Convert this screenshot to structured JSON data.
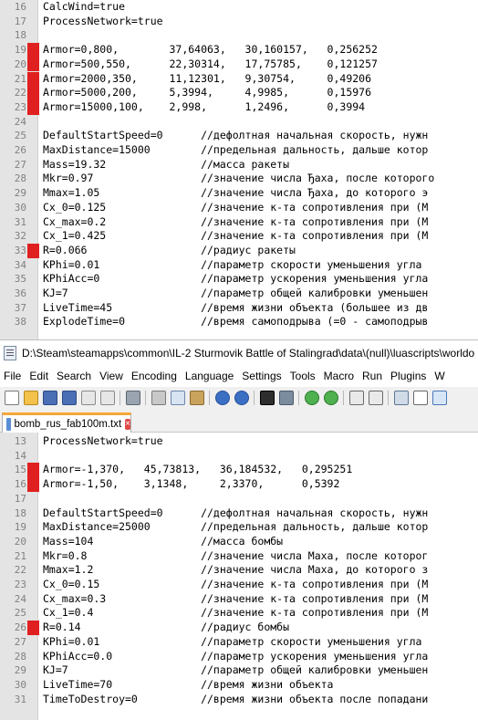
{
  "top_editor": {
    "lines": [
      {
        "num": "16",
        "text": "CalcWind=true",
        "marked": false
      },
      {
        "num": "17",
        "text": "ProcessNetwork=true",
        "marked": false
      },
      {
        "num": "18",
        "text": "",
        "marked": false
      },
      {
        "num": "19",
        "text": "Armor=0,800,        37,64063,   30,160157,   0,256252",
        "marked": true
      },
      {
        "num": "20",
        "text": "Armor=500,550,      22,30314,   17,75785,    0,121257",
        "marked": true
      },
      {
        "num": "21",
        "text": "Armor=2000,350,     11,12301,   9,30754,     0,49206",
        "marked": true
      },
      {
        "num": "22",
        "text": "Armor=5000,200,     5,3994,     4,9985,      0,15976",
        "marked": true
      },
      {
        "num": "23",
        "text": "Armor=15000,100,    2,998,      1,2496,      0,3994",
        "marked": true
      },
      {
        "num": "24",
        "text": "",
        "marked": false
      },
      {
        "num": "25",
        "text": "DefaultStartSpeed=0      //дефолтная начальная скорость, нужн",
        "marked": false
      },
      {
        "num": "26",
        "text": "MaxDistance=15000        //предельная дальность, дальше котор",
        "marked": false
      },
      {
        "num": "27",
        "text": "Mass=19.32               //масса ракеты",
        "marked": false
      },
      {
        "num": "28",
        "text": "Mkr=0.97                 //значение числа Ђаха, после которого",
        "marked": false
      },
      {
        "num": "29",
        "text": "Mmax=1.05                //значение числа Ђаха, до которого э",
        "marked": false
      },
      {
        "num": "30",
        "text": "Cx_0=0.125               //значение к-та сопротивления при (М",
        "marked": false
      },
      {
        "num": "31",
        "text": "Cx_max=0.2               //значение к-та сопротивления при (М",
        "marked": false
      },
      {
        "num": "32",
        "text": "Cx_1=0.425               //значение к-та сопротивления при (М",
        "marked": false
      },
      {
        "num": "33",
        "text": "R=0.066                  //радиус ракеты",
        "marked": true
      },
      {
        "num": "34",
        "text": "KPhi=0.01                //параметр скорости уменьшения угла",
        "marked": false
      },
      {
        "num": "35",
        "text": "KPhiAcc=0                //параметр ускорения уменьшения угла",
        "marked": false
      },
      {
        "num": "36",
        "text": "KJ=7                     //параметр общей калибровки уменьшен",
        "marked": false
      },
      {
        "num": "37",
        "text": "LiveTime=45              //время жизни объекта (большее из дв",
        "marked": false
      },
      {
        "num": "38",
        "text": "ExplodeTime=0            //время самоподрыва (=0 - самоподрыв",
        "marked": false
      }
    ]
  },
  "window": {
    "title": "D:\\Steam\\steamapps\\common\\IL-2 Sturmovik Battle of Stalingrad\\data\\(null)\\luascripts\\worldo"
  },
  "menubar": {
    "items": [
      "File",
      "Edit",
      "Search",
      "View",
      "Encoding",
      "Language",
      "Settings",
      "Tools",
      "Macro",
      "Run",
      "Plugins",
      "W"
    ]
  },
  "toolbar": {
    "icons": [
      "new-file-icon",
      "open-file-icon",
      "save-icon",
      "save-all-icon",
      "close-icon",
      "close-all-icon",
      "print-icon",
      "cut-icon",
      "copy-icon",
      "paste-icon",
      "undo-icon",
      "redo-icon",
      "find-icon",
      "replace-icon",
      "zoom-in-icon",
      "zoom-out-icon",
      "sync-v-icon",
      "sync-h-icon",
      "word-wrap-icon",
      "show-all-chars-icon",
      "indent-guide-icon"
    ]
  },
  "tab": {
    "label": "bomb_rus_fab100m.txt"
  },
  "bottom_editor": {
    "lines": [
      {
        "num": "13",
        "text": "ProcessNetwork=true",
        "marked": false
      },
      {
        "num": "14",
        "text": "",
        "marked": false
      },
      {
        "num": "15",
        "text": "Armor=-1,370,   45,73813,   36,184532,   0,295251",
        "marked": true
      },
      {
        "num": "16",
        "text": "Armor=-1,50,    3,1348,     2,3370,      0,5392",
        "marked": true
      },
      {
        "num": "17",
        "text": "",
        "marked": false
      },
      {
        "num": "18",
        "text": "DefaultStartSpeed=0      //дефолтная начальная скорость, нужн",
        "marked": false
      },
      {
        "num": "19",
        "text": "MaxDistance=25000        //предельная дальность, дальше котор",
        "marked": false
      },
      {
        "num": "20",
        "text": "Mass=104                 //масса бомбы",
        "marked": false
      },
      {
        "num": "21",
        "text": "Mkr=0.8                  //значение числа Маха, после которог",
        "marked": false
      },
      {
        "num": "22",
        "text": "Mmax=1.2                 //значение числа Маха, до которого з",
        "marked": false
      },
      {
        "num": "23",
        "text": "Cx_0=0.15                //значение к-та сопротивления при (М",
        "marked": false
      },
      {
        "num": "24",
        "text": "Cx_max=0.3               //значение к-та сопротивления при (М",
        "marked": false
      },
      {
        "num": "25",
        "text": "Cx_1=0.4                 //значение к-та сопротивления при (М",
        "marked": false
      },
      {
        "num": "26",
        "text": "R=0.14                   //радиус бомбы",
        "marked": true
      },
      {
        "num": "27",
        "text": "KPhi=0.01                //параметр скорости уменьшения угла",
        "marked": false
      },
      {
        "num": "28",
        "text": "KPhiAcc=0.0              //параметр ускорения уменьшения угла",
        "marked": false
      },
      {
        "num": "29",
        "text": "KJ=7                     //параметр общей калибровки уменьшен",
        "marked": false
      },
      {
        "num": "30",
        "text": "LiveTime=70              //время жизни объекта",
        "marked": false
      },
      {
        "num": "31",
        "text": "TimeToDestroy=0          //время жизни объекта после попадани",
        "marked": false
      }
    ]
  },
  "colors": {
    "marker": "#e02020",
    "gutter": "#e4e4e4",
    "tab_accent": "#f7a637"
  }
}
